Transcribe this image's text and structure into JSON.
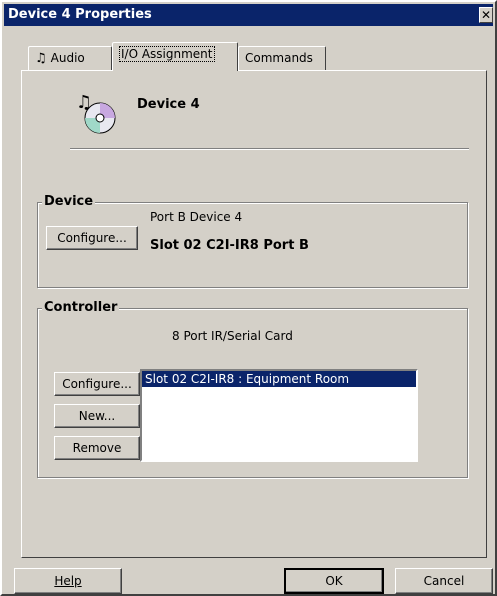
{
  "window": {
    "title": "Device 4 Properties",
    "close_glyph": "✕"
  },
  "tabs": [
    {
      "label": "Audio",
      "icon": "music-note-icon"
    },
    {
      "label": "I/O Assignment"
    },
    {
      "label": "Commands"
    }
  ],
  "header": {
    "device_name": "Device 4",
    "icon": "cd-music-icon"
  },
  "device_group": {
    "title": "Device",
    "port_text": "Port B Device 4",
    "configure_label": "Configure...",
    "slot_text": "Slot 02 C2I-IR8 Port B"
  },
  "controller_group": {
    "title": "Controller",
    "card_text": "8 Port IR/Serial Card",
    "configure_label": "Configure...",
    "new_label": "New...",
    "remove_label": "Remove",
    "list_items": [
      "Slot 02 C2I-IR8 : Equipment Room"
    ],
    "selected_index": 0
  },
  "footer": {
    "help_label": "Help",
    "ok_label": "OK",
    "cancel_label": "Cancel"
  },
  "colors": {
    "title_bar": "#0a246a",
    "dialog_bg": "#d4d0c8",
    "selection": "#0a246a"
  }
}
